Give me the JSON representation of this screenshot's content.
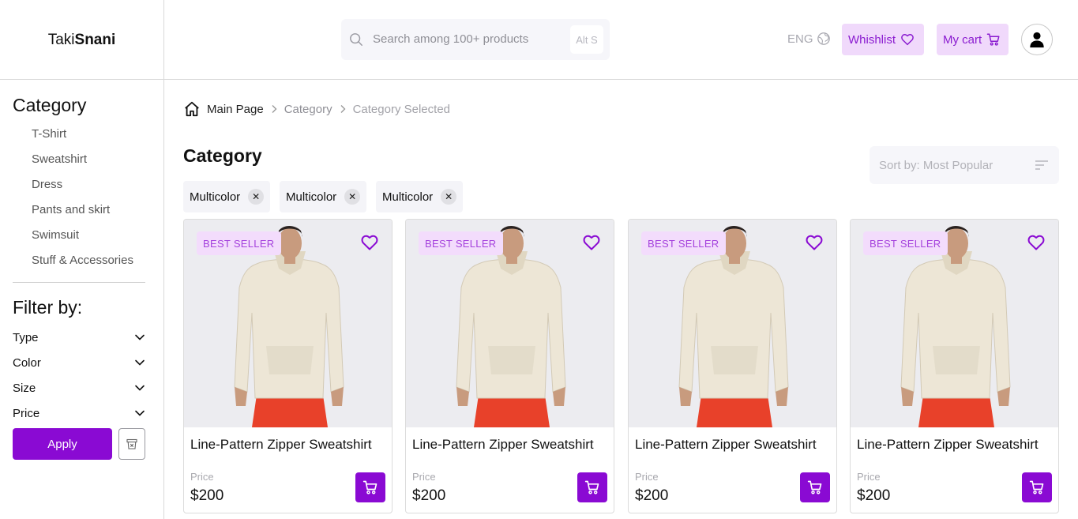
{
  "header": {
    "logo_light": "Taki",
    "logo_bold": "Snani",
    "search_placeholder": "Search among 100+ products",
    "search_shortcut": "Alt S",
    "language": "ENG",
    "wishlist_label": "Whishlist",
    "cart_label": "My cart"
  },
  "sidebar": {
    "category_heading": "Category",
    "categories": [
      "T-Shirt",
      "Sweatshirt",
      "Dress",
      "Pants and skirt",
      "Swimsuit",
      "Stuff & Accessories"
    ],
    "filter_heading": "Filter by:",
    "filters": [
      "Type",
      "Color",
      "Size",
      "Price"
    ],
    "apply_label": "Apply"
  },
  "breadcrumb": {
    "items": [
      "Main Page",
      "Category",
      "Category Selected"
    ]
  },
  "main": {
    "title": "Category",
    "sort_label": "Sort by: Most Popular",
    "chips": [
      "Multicolor",
      "Multicolor",
      "Multicolor"
    ],
    "products": [
      {
        "badge": "BEST SELLER",
        "title": "Line-Pattern Zipper Sweatshirt",
        "price_label": "Price",
        "price": "$200"
      },
      {
        "badge": "BEST SELLER",
        "title": "Line-Pattern Zipper Sweatshirt",
        "price_label": "Price",
        "price": "$200"
      },
      {
        "badge": "BEST SELLER",
        "title": "Line-Pattern Zipper Sweatshirt",
        "price_label": "Price",
        "price": "$200"
      },
      {
        "badge": "BEST SELLER",
        "title": "Line-Pattern Zipper Sweatshirt",
        "price_label": "Price",
        "price": "$200"
      }
    ]
  },
  "colors": {
    "accent": "#8a0ad3",
    "accent_light": "#f0d9fb",
    "badge_text": "#a542dd"
  },
  "icons": [
    "search-icon",
    "globe-icon",
    "heart-icon",
    "cart-icon",
    "user-icon",
    "home-icon",
    "chevron-down-icon",
    "trash-icon",
    "sort-icon",
    "close-icon"
  ]
}
